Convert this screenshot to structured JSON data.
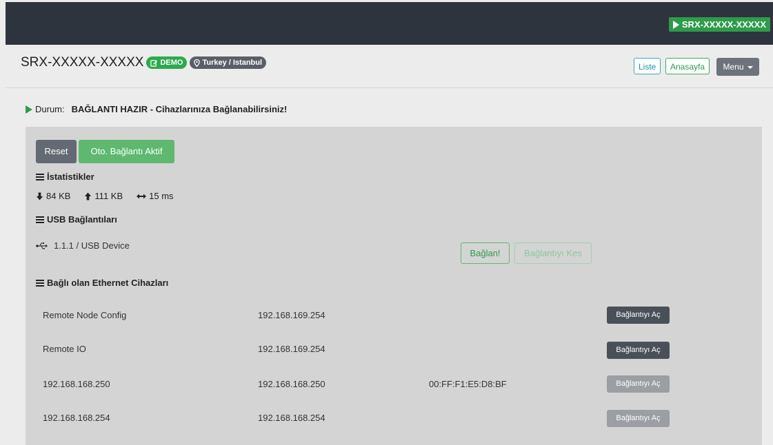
{
  "topbar": {
    "device_id": "SRX-XXXXX-XXXXX"
  },
  "header": {
    "title": "SRX-XXXXX-XXXXX",
    "demo_badge": "DEMO",
    "location_badge": "Turkey / Istanbul",
    "nav": {
      "liste": "Liste",
      "anasayfa": "Anasayfa",
      "menu": "Menu"
    }
  },
  "status": {
    "label": "Durum:",
    "value": "BAĞLANTI HAZIR - Cihazlarınıza Bağlanabilirsiniz!"
  },
  "controls": {
    "reset": "Reset",
    "auto_connect": "Oto. Bağlantı Aktif"
  },
  "stats": {
    "heading": "İstatistikler",
    "download": "84 KB",
    "upload": "111 KB",
    "latency": "15 ms"
  },
  "usb": {
    "heading": "USB Bağlantıları",
    "device": "1.1.1 / USB Device",
    "connect": "Bağlan!",
    "disconnect": "Bağlantıyı Kes"
  },
  "ethernet": {
    "heading": "Bağlı olan Ethernet Cihazları",
    "rows": [
      {
        "name": "Remote Node Config",
        "ip": "192.168.169.254",
        "mac": "",
        "action": "Bağlantıyı Aç",
        "enabled": true
      },
      {
        "name": "Remote IO",
        "ip": "192.168.169.254",
        "mac": "",
        "action": "Bağlantıyı Aç",
        "enabled": true
      },
      {
        "name": "192.168.168.250",
        "ip": "192.168.168.250",
        "mac": "00:FF:F1:E5:D8:BF",
        "action": "Bağlantıyı Aç",
        "enabled": false
      },
      {
        "name": "192.168.168.254",
        "ip": "192.168.168.254",
        "mac": "",
        "action": "Bağlantıyı Aç",
        "enabled": false
      }
    ]
  },
  "colors": {
    "topbar": "#2e343e",
    "success": "#2e9b4a",
    "panel": "#d4d4d4",
    "info": "#3aa7c6",
    "secondary": "#6e737b"
  }
}
